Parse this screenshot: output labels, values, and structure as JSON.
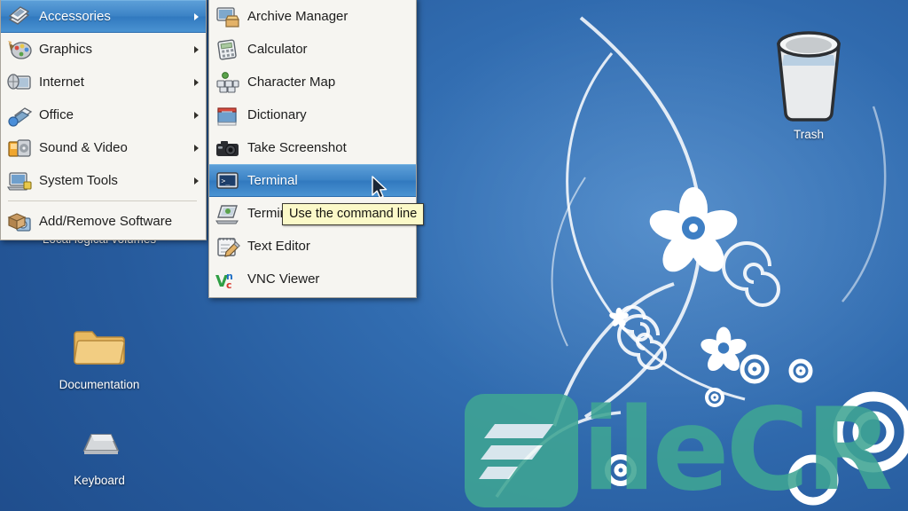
{
  "desktop": {
    "background_color": "#2a5f9e",
    "icons": [
      {
        "name": "lvm",
        "label": "Local logical\nvolumes",
        "icon": "drive-icon"
      },
      {
        "name": "documentation",
        "label": "Documentation",
        "icon": "folder-icon"
      },
      {
        "name": "keyboard",
        "label": "Keyboard",
        "icon": "keyboard-icon"
      },
      {
        "name": "trash",
        "label": "Trash",
        "icon": "trash-icon"
      }
    ]
  },
  "main_menu": {
    "items": [
      {
        "label": "Accessories",
        "icon": "accessories-icon",
        "submenu": true,
        "selected": true
      },
      {
        "label": "Graphics",
        "icon": "graphics-icon",
        "submenu": true,
        "selected": false
      },
      {
        "label": "Internet",
        "icon": "internet-icon",
        "submenu": true,
        "selected": false
      },
      {
        "label": "Office",
        "icon": "office-icon",
        "submenu": true,
        "selected": false
      },
      {
        "label": "Sound & Video",
        "icon": "sound-video-icon",
        "submenu": true,
        "selected": false
      },
      {
        "label": "System Tools",
        "icon": "system-tools-icon",
        "submenu": true,
        "selected": false
      },
      {
        "label": "Add/Remove Software",
        "icon": "package-icon",
        "submenu": false,
        "selected": false
      }
    ]
  },
  "submenu": {
    "items": [
      {
        "label": "Archive Manager",
        "icon": "archive-manager-icon",
        "selected": false
      },
      {
        "label": "Calculator",
        "icon": "calculator-icon",
        "selected": false
      },
      {
        "label": "Character Map",
        "icon": "character-map-icon",
        "selected": false
      },
      {
        "label": "Dictionary",
        "icon": "dictionary-icon",
        "selected": false
      },
      {
        "label": "Take Screenshot",
        "icon": "camera-icon",
        "selected": false
      },
      {
        "label": "Terminal",
        "icon": "terminal-icon",
        "selected": true
      },
      {
        "label": "Terminal",
        "icon": "terminal-alt-icon",
        "selected": false
      },
      {
        "label": "Text Editor",
        "icon": "text-editor-icon",
        "selected": false
      },
      {
        "label": "VNC Viewer",
        "icon": "vnc-viewer-icon",
        "selected": false
      }
    ]
  },
  "tooltip": {
    "text": "Use the command line"
  },
  "watermark": {
    "text": "ileCR",
    "color": "#3fa594"
  },
  "colors": {
    "menu_background": "#f6f5f1",
    "menu_border": "#a8a49c",
    "selection_blue": "#3c83c6",
    "tooltip_background": "#fbf9c8",
    "desktop_blue": "#2a5f9e"
  }
}
